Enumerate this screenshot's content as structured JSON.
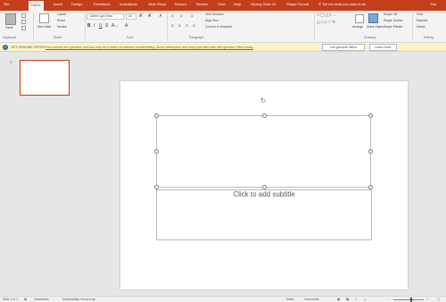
{
  "titlebar": {
    "tabs": [
      {
        "label": "File"
      },
      {
        "label": "Home"
      },
      {
        "label": "Insert"
      },
      {
        "label": "Design"
      },
      {
        "label": "Transitions"
      },
      {
        "label": "Animations"
      },
      {
        "label": "Slide Show"
      },
      {
        "label": "Record"
      },
      {
        "label": "Review"
      },
      {
        "label": "View"
      },
      {
        "label": "Help"
      },
      {
        "label": "iSpring Suite 10"
      },
      {
        "label": "Shape Format"
      }
    ],
    "tell_me": "Tell me what you want to do",
    "user": "Sha",
    "accent": "#c43e1c"
  },
  "ribbon": {
    "clipboard": {
      "paste": "Paste",
      "label": "Clipboard"
    },
    "slides": {
      "new_slide": "New Slide",
      "layout": "Layout",
      "reset": "Reset",
      "section": "Section",
      "label": "Slides"
    },
    "font": {
      "family": "Calibri Light (Hea",
      "size": "40",
      "label": "Font"
    },
    "paragraph": {
      "text_direction": "Text Direction",
      "align_text": "Align Text",
      "smartart": "Convert to SmartArt",
      "label": "Paragraph"
    },
    "drawing": {
      "arrange": "Arrange",
      "quick_styles": "Quick Styles",
      "shape_fill": "Shape Fill",
      "shape_outline": "Shape Outline",
      "shape_effects": "Shape Effects",
      "label": "Drawing"
    },
    "editing": {
      "find": "Find",
      "replace": "Replace",
      "select": "Select",
      "label": "Editing"
    }
  },
  "message_bar": {
    "label": "GET GENUINE OFFICE",
    "text": "Your license isn't genuine, and you may be a victim of software counterfeiting. Avoid interruption and keep your files safe with genuine Office today.",
    "primary_button": "Get genuine Office",
    "secondary_button": "Learn more"
  },
  "thumbnails": [
    {
      "number": "1"
    }
  ],
  "slide": {
    "subtitle_placeholder": "Click to add subtitle"
  },
  "statusbar": {
    "slide_counter": "Slide 1 of 1",
    "language": "Indonesian",
    "accessibility": "Accessibility: Good to go",
    "notes": "Notes",
    "comments": "Comments",
    "zoom_level": 0.6
  }
}
